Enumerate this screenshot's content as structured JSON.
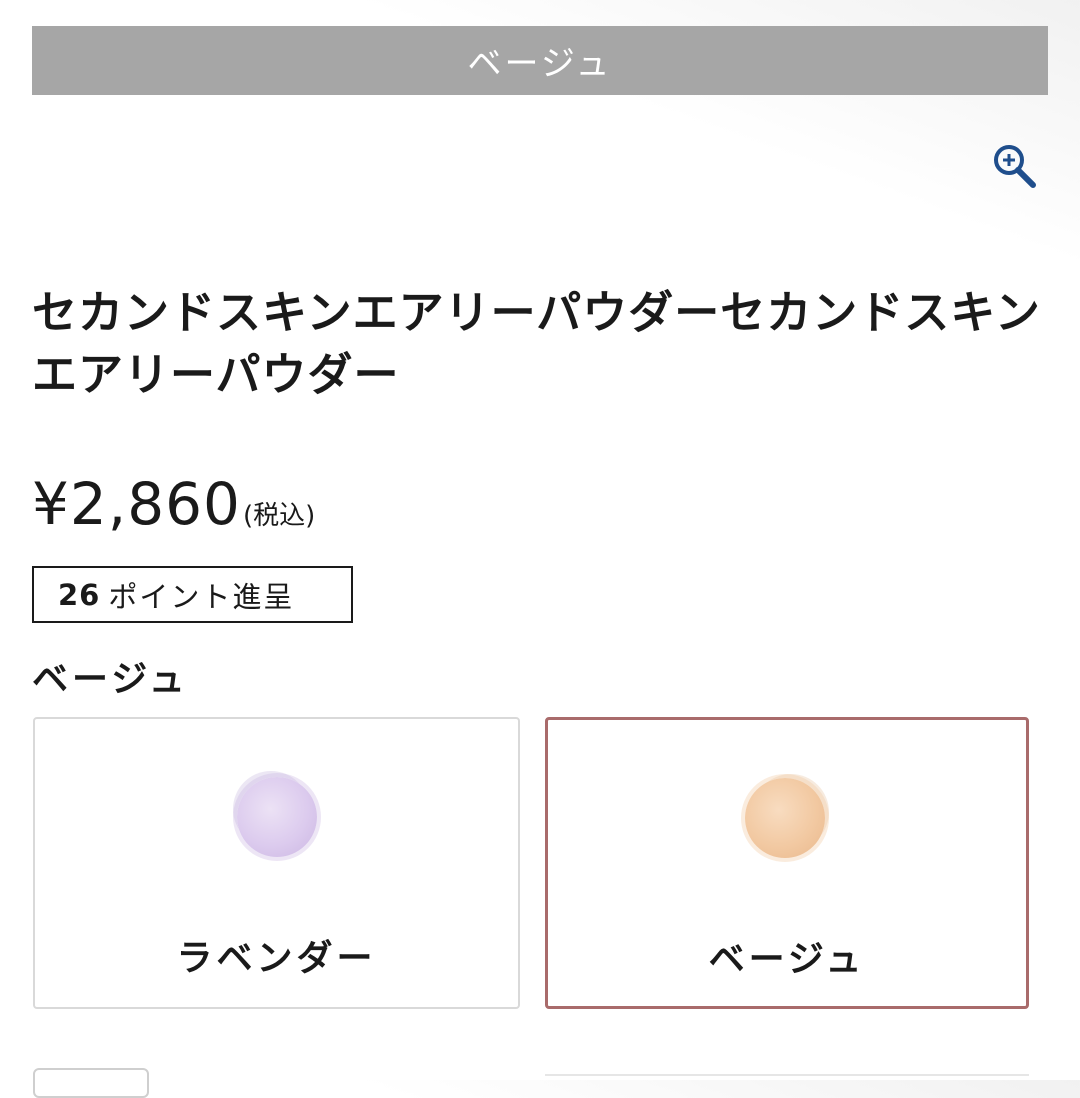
{
  "banner": {
    "text": "ベージュ"
  },
  "zoom": {
    "icon": "zoom-in-icon",
    "color": "#1f4e8c"
  },
  "product": {
    "title": "セカンドスキンエアリーパウダーセカンドスキンエアリーパウダー",
    "price": "¥2,860",
    "tax_note": "(税込)",
    "points_number": "26",
    "points_text": "ポイント進呈"
  },
  "variant": {
    "selected_label": "ベージュ",
    "options": [
      {
        "label": "ラベンダー",
        "color": "#dccbee",
        "selected": false
      },
      {
        "label": "ベージュ",
        "color": "#f2c9a2",
        "selected": true
      }
    ],
    "selected_border_color": "#a96b6b"
  }
}
